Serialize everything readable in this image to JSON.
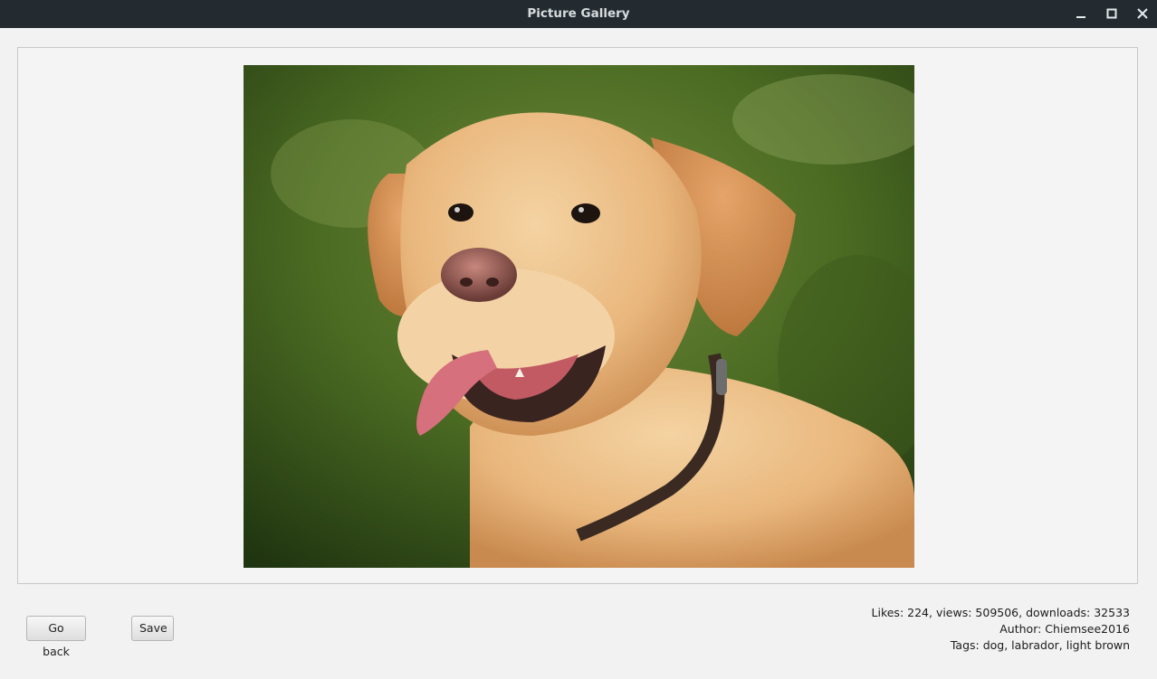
{
  "window": {
    "title": "Picture Gallery",
    "controls": [
      "minimize-icon",
      "maximize-icon",
      "close-icon"
    ]
  },
  "picture": {
    "subject": "dog-photo"
  },
  "buttons": {
    "go_back": "Go back",
    "save": "Save"
  },
  "info": {
    "stats": "Likes: 224, views: 509506, downloads: 32533",
    "author": "Author: Chiemsee2016",
    "tags": "Tags: dog, labrador, light brown"
  }
}
